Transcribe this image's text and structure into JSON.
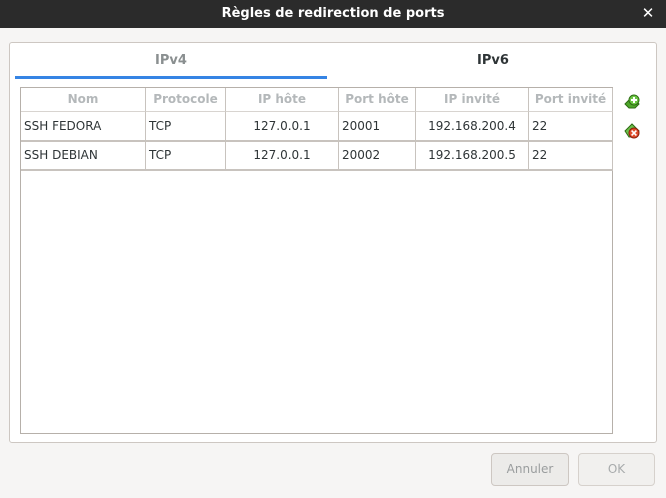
{
  "window": {
    "title": "Règles de redirection de ports",
    "close_icon": "close-icon"
  },
  "tabs": [
    {
      "label": "IPv4",
      "active": true
    },
    {
      "label": "IPv6",
      "active": false
    }
  ],
  "table": {
    "headers": [
      "Nom",
      "Protocole",
      "IP hôte",
      "Port hôte",
      "IP invité",
      "Port invité"
    ],
    "rows": [
      [
        "SSH FEDORA",
        "TCP",
        "127.0.0.1",
        "20001",
        "192.168.200.4",
        "22"
      ],
      [
        "SSH DEBIAN",
        "TCP",
        "127.0.0.1",
        "20002",
        "192.168.200.5",
        "22"
      ]
    ]
  },
  "tools": {
    "add_icon": "add-rule-icon",
    "remove_icon": "remove-rule-icon"
  },
  "buttons": {
    "cancel": "Annuler",
    "ok": "OK"
  },
  "colors": {
    "accent": "#3584e4",
    "titlebar": "#2b2b2b",
    "add_icon": "#4ea62a",
    "remove_icon": "#e04b2a"
  }
}
